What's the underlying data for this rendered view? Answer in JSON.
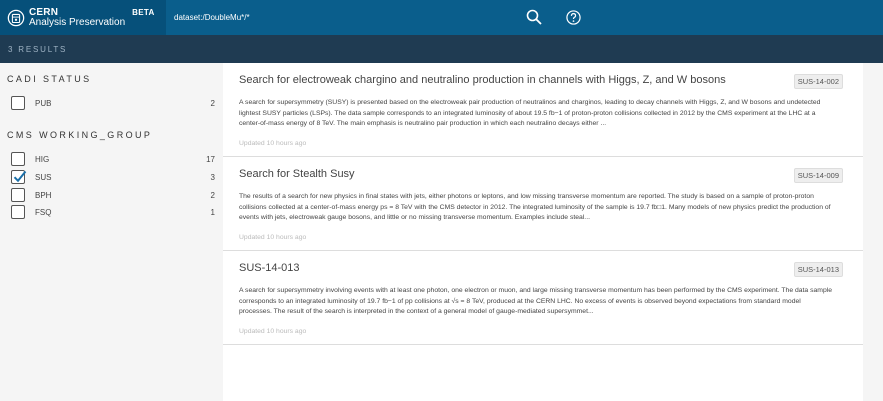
{
  "header": {
    "brand_line1": "CERN",
    "brand_line2": "Analysis Preservation",
    "beta": "BETA",
    "search_value": "dataset:/DoubleMu*/*",
    "colors": {
      "topbar": "#0a5e8c",
      "subbar": "#1f3b52"
    }
  },
  "results": {
    "count_label": "3 RESULTS"
  },
  "facets": {
    "cadi": {
      "title": "CADI STATUS",
      "items": [
        {
          "label": "PUB",
          "count": "2",
          "checked": false
        }
      ]
    },
    "wg": {
      "title": "CMS WORKING_GROUP",
      "items": [
        {
          "label": "HIG",
          "count": "17",
          "checked": false
        },
        {
          "label": "SUS",
          "count": "3",
          "checked": true
        },
        {
          "label": "BPH",
          "count": "2",
          "checked": false
        },
        {
          "label": "FSQ",
          "count": "1",
          "checked": false
        }
      ]
    }
  },
  "cards": [
    {
      "title": "Search for electroweak chargino and neutralino production in channels with Higgs, Z, and W bosons",
      "badge": "SUS-14-002",
      "desc": "A search for supersymmetry (SUSY) is presented based on the electroweak pair production of neutralinos and charginos, leading to decay channels with Higgs, Z, and W bosons and undetected lightest SUSY particles (LSPs). The data sample corresponds to an integrated luminosity of about 19.5 fb−1 of proton-proton collisions collected in 2012 by the CMS experiment at the LHC at a center-of-mass energy of 8 TeV. The main emphasis is neutralino pair production in which each neutralino decays either ...",
      "time": "Updated 10 hours ago"
    },
    {
      "title": "Search for Stealth Susy",
      "badge": "SUS-14-009",
      "desc": "The results of a search for new physics in final states with jets, either photons or leptons, and low missing transverse momentum are reported. The study is based on a sample of proton-proton collisions collected at a center-of-mass energy ps = 8 TeV with the CMS detector in 2012. The integrated luminosity of the sample is 19.7 fb□1. Many models of new physics predict the production of events with jets, electroweak gauge bosons, and little or no missing transverse momentum. Examples include steal...",
      "time": "Updated 10 hours ago"
    },
    {
      "title": "SUS-14-013",
      "badge": "SUS-14-013",
      "desc": "A search for supersymmetry involving events with at least one photon, one electron or muon, and large missing transverse momentum has been performed by the CMS experiment. The data sample corresponds to an integrated luminosity of 19.7 fb−1 of pp collisions at √s = 8 TeV, produced at the CERN LHC. No excess of events is observed beyond expectations from standard model processes. The result of the search is interpreted in the context of a general model of gauge-mediated supersymmet...",
      "time": "Updated 10 hours ago"
    }
  ]
}
